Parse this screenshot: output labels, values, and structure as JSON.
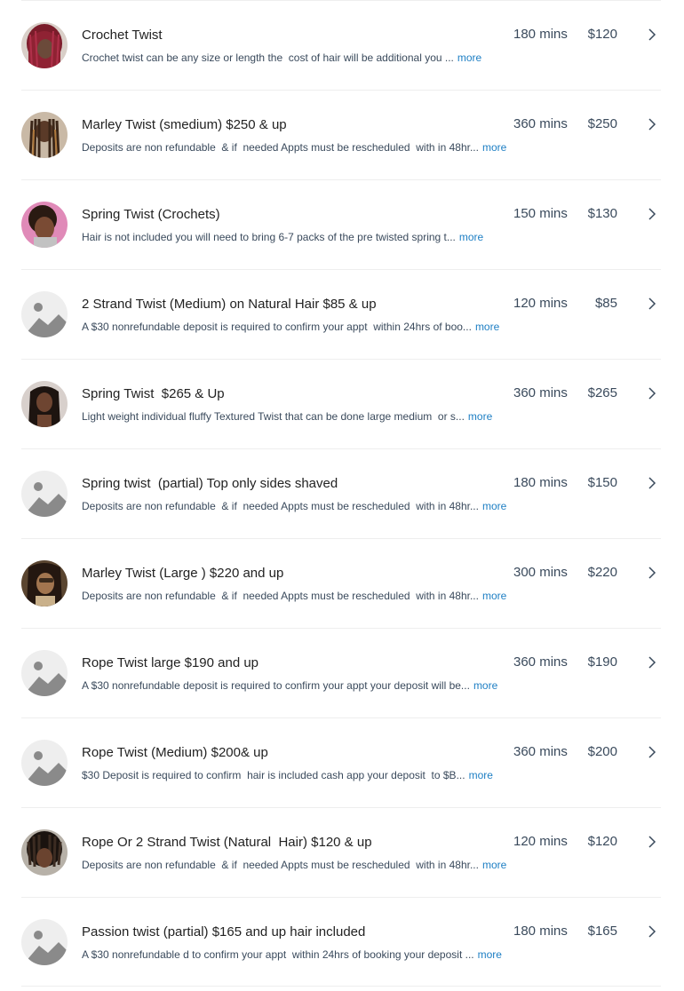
{
  "services": [
    {
      "title": "Crochet Twist",
      "description": "Crochet twist can be any size or length the  cost of hair will be additional you ...",
      "more": "more",
      "duration": "180 mins",
      "price": "$120",
      "avatar": "photo-red-braids"
    },
    {
      "title": "Marley Twist (smedium) $250 & up",
      "description": "Deposits are non refundable  & if  needed Appts must be rescheduled  with in 48hr...",
      "more": "more",
      "duration": "360 mins",
      "price": "$250",
      "avatar": "photo-long-twists"
    },
    {
      "title": "Spring Twist (Crochets)",
      "description": "Hair is not included you will need to bring 6-7 packs of the pre twisted spring t...",
      "more": "more",
      "duration": "150 mins",
      "price": "$130",
      "avatar": "photo-spring-twist-pink"
    },
    {
      "title": "2 Strand Twist (Medium) on Natural Hair $85 & up",
      "description": "A $30 nonrefundable deposit is required to confirm your appt  within 24hrs of boo...",
      "more": "more",
      "duration": "120 mins",
      "price": "$85",
      "avatar": "placeholder-image"
    },
    {
      "title": "Spring Twist  $265 & Up",
      "description": "Light weight individual fluffy Textured Twist that can be done large medium  or s...",
      "more": "more",
      "duration": "360 mins",
      "price": "$265",
      "avatar": "photo-long-dark-twists"
    },
    {
      "title": "Spring twist  (partial) Top only sides shaved",
      "description": "Deposits are non refundable  & if  needed Appts must be rescheduled  with in 48hr...",
      "more": "more",
      "duration": "180 mins",
      "price": "$150",
      "avatar": "placeholder-image"
    },
    {
      "title": "Marley Twist (Large ) $220 and up",
      "description": "Deposits are non refundable  & if  needed Appts must be rescheduled  with in 48hr...",
      "more": "more",
      "duration": "300 mins",
      "price": "$220",
      "avatar": "photo-marley-large"
    },
    {
      "title": "Rope Twist large $190 and up",
      "description": "A $30 nonrefundable deposit is required to confirm your appt your deposit will be...",
      "more": "more",
      "duration": "360 mins",
      "price": "$190",
      "avatar": "placeholder-image"
    },
    {
      "title": "Rope Twist (Medium) $200& up",
      "description": "$30 Deposit is required to confirm  hair is included cash app your deposit  to $B...",
      "more": "more",
      "duration": "360 mins",
      "price": "$200",
      "avatar": "placeholder-image"
    },
    {
      "title": "Rope Or 2 Strand Twist (Natural  Hair) $120 & up",
      "description": "Deposits are non refundable  & if  needed Appts must be rescheduled  with in 48hr...",
      "more": "more",
      "duration": "120 mins",
      "price": "$120",
      "avatar": "photo-natural-twists"
    },
    {
      "title": "Passion twist (partial) $165 and up hair included",
      "description": "A $30 nonrefundable d to confirm your appt  within 24hrs of booking your deposit ...",
      "more": "more",
      "duration": "180 mins",
      "price": "$165",
      "avatar": "placeholder-image"
    }
  ],
  "colors": {
    "accent_link": "#1e7fc4",
    "text": "#222222",
    "muted": "#3a4a5c",
    "divider": "#eeeeee",
    "placeholder_bg": "#eeeeee",
    "placeholder_fg": "#8a8a8a"
  },
  "icons": {
    "row_action": "chevron-right-icon"
  }
}
